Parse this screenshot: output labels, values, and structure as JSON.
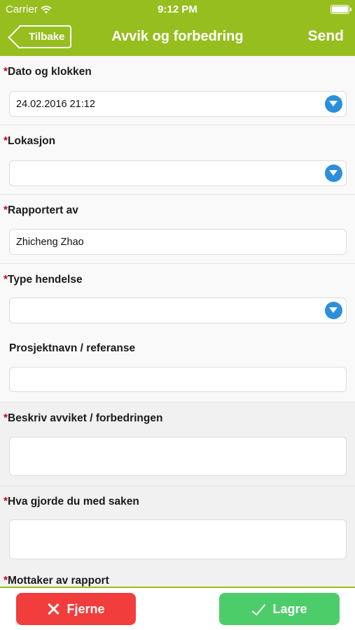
{
  "status_bar": {
    "carrier": "Carrier",
    "time": "9:12 PM",
    "wifi_icon": "wifi-icon",
    "battery_icon": "battery-icon"
  },
  "nav": {
    "back_label": "Tilbake",
    "title": "Avvik og forbedring",
    "send_label": "Send"
  },
  "form": {
    "required_marker": "*",
    "date": {
      "label": "Dato og klokken",
      "value": "24.02.2016 21:12"
    },
    "location": {
      "label": "Lokasjon",
      "value": ""
    },
    "reported_by": {
      "label": "Rapportert av",
      "value": "Zhicheng Zhao"
    },
    "event_type": {
      "label": "Type hendelse",
      "value": ""
    },
    "project": {
      "label": "Prosjektnavn / referanse",
      "value": ""
    },
    "description": {
      "label": "Beskriv avviket / forbedringen",
      "value": ""
    },
    "action": {
      "label": "Hva gjorde du med saken",
      "value": ""
    },
    "recipient": {
      "label": "Mottaker av rapport"
    }
  },
  "footer": {
    "remove_label": "Fjerne",
    "save_label": "Lagre"
  },
  "colors": {
    "brand_green": "#96be1e",
    "remove_red": "#f23d3d",
    "save_green": "#4dcd6a",
    "dropdown_blue": "#2d8fdc",
    "required_red": "#d0021b"
  }
}
